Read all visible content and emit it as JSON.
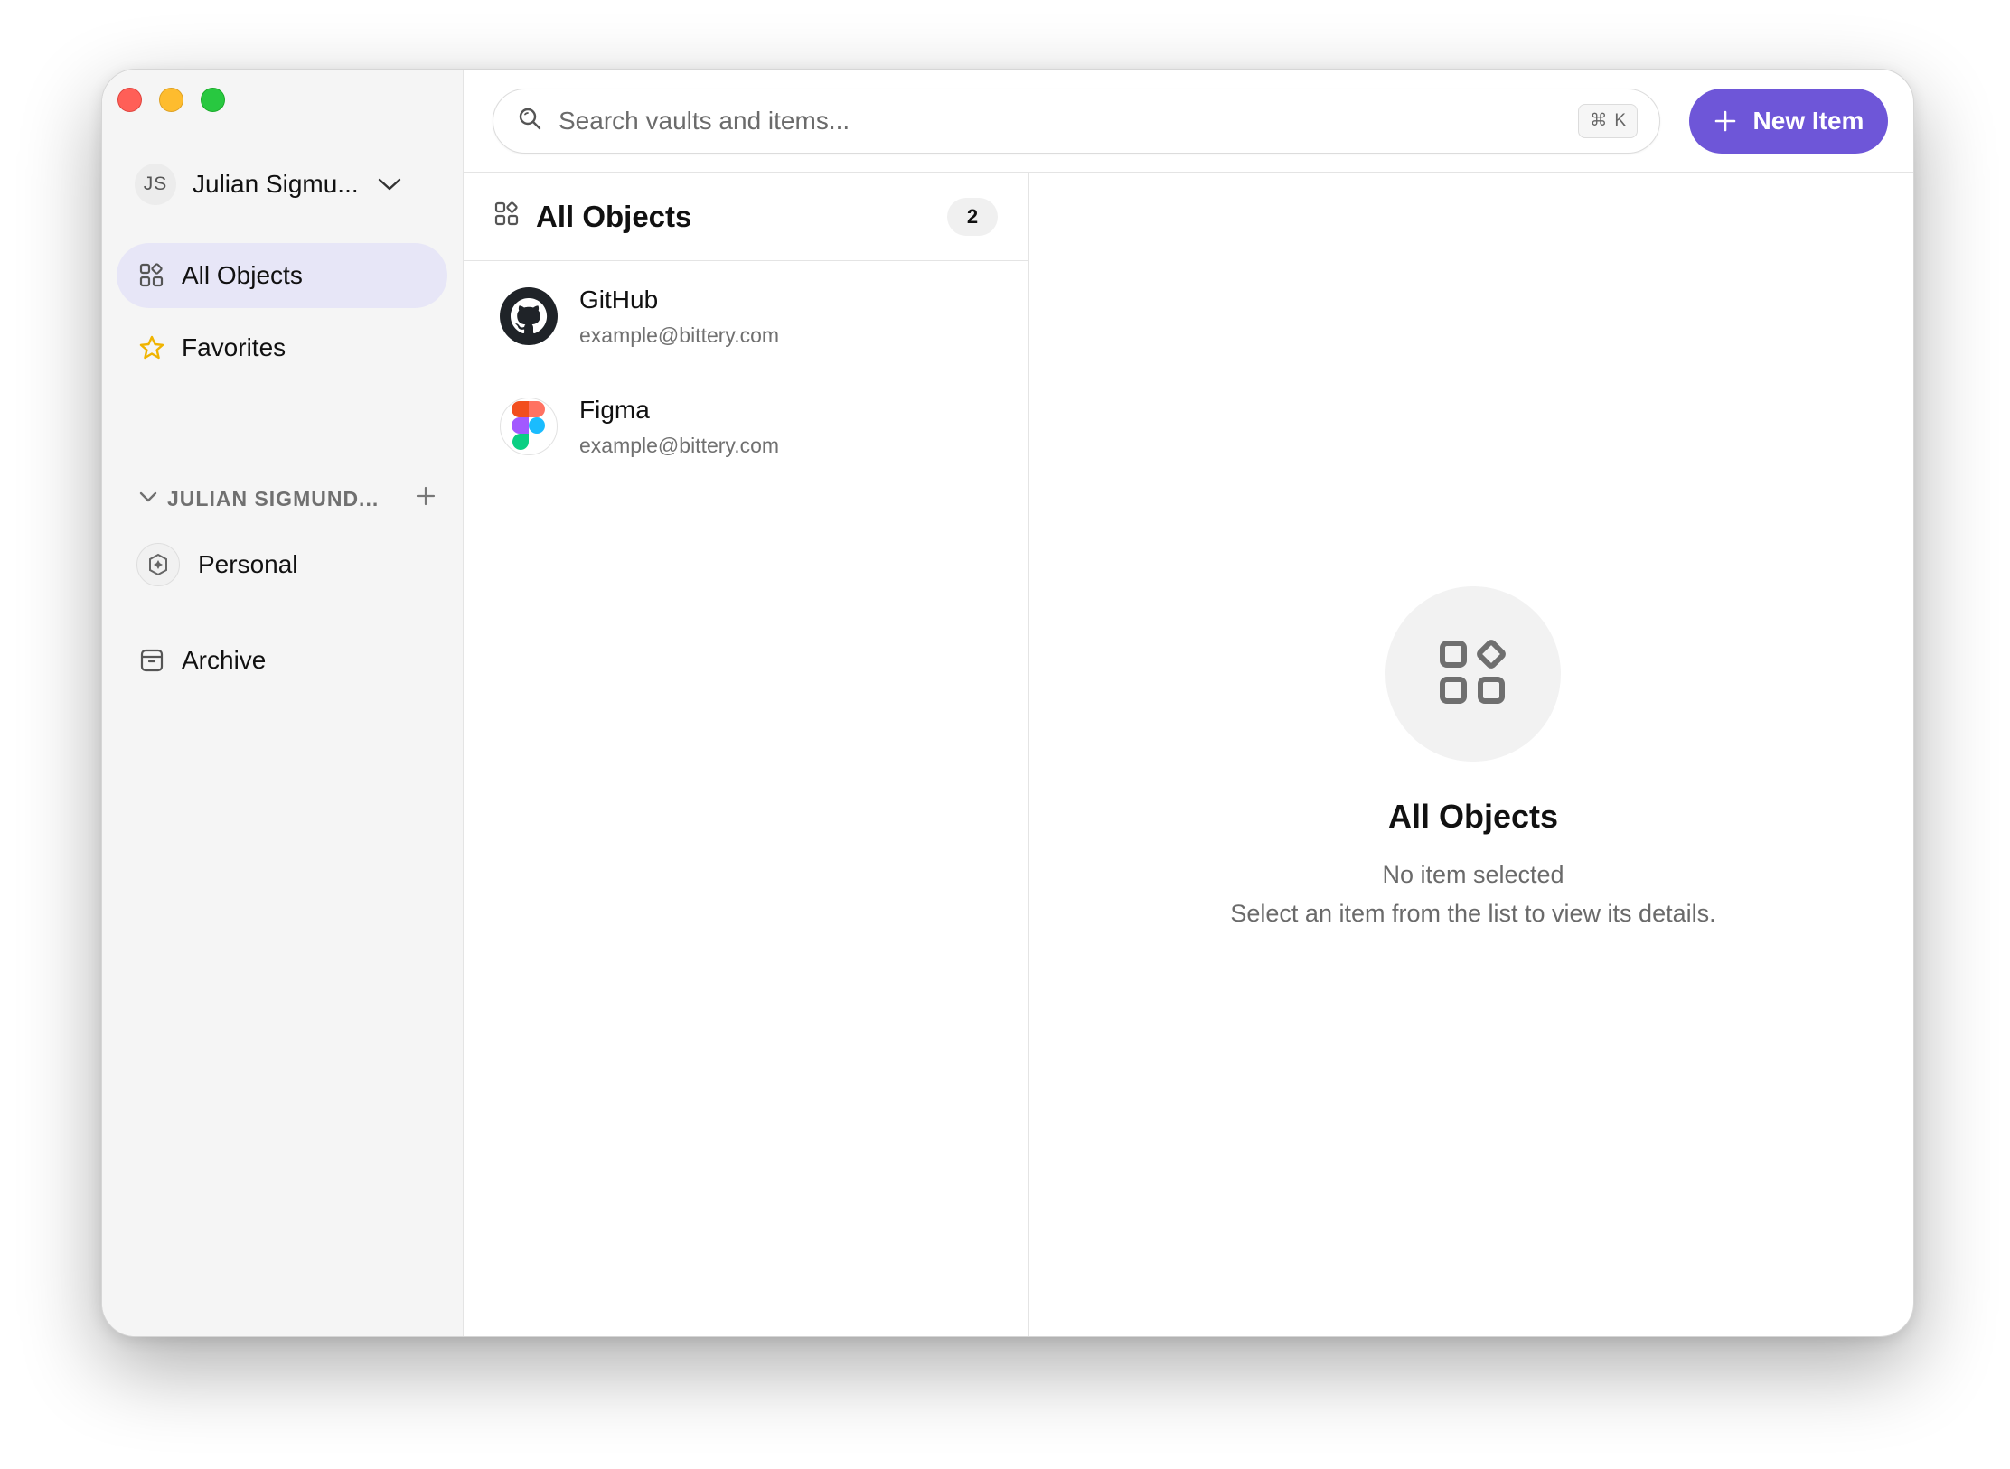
{
  "window": {
    "traffic_lights": [
      "close",
      "minimize",
      "zoom"
    ]
  },
  "account": {
    "initials": "JS",
    "name": "Julian Sigmu..."
  },
  "sidebar": {
    "items": [
      {
        "label": "All Objects",
        "icon": "grid-icon",
        "active": true
      },
      {
        "label": "Favorites",
        "icon": "star-icon",
        "active": false
      }
    ],
    "section": {
      "label": "JULIAN SIGMUND..."
    },
    "vaults": [
      {
        "label": "Personal",
        "icon": "vault-icon"
      }
    ],
    "archive": {
      "label": "Archive",
      "icon": "archive-icon"
    }
  },
  "search": {
    "placeholder": "Search vaults and items...",
    "shortcut_symbol": "⌘",
    "shortcut_key": "K"
  },
  "toolbar": {
    "new_label": "New Item"
  },
  "list": {
    "title": "All Objects",
    "count": "2",
    "items": [
      {
        "title": "GitHub",
        "subtitle": "example@bittery.com",
        "icon": "github-icon"
      },
      {
        "title": "Figma",
        "subtitle": "example@bittery.com",
        "icon": "figma-icon"
      }
    ]
  },
  "detail": {
    "title": "All Objects",
    "line1": "No item selected",
    "line2": "Select an item from the list to view its details."
  },
  "colors": {
    "accent": "#6e56d8",
    "active_bg": "#e7e6f7",
    "sidebar_bg": "#f5f5f5",
    "star": "#f0b400",
    "close": "#ff5f57",
    "minimize": "#febc2e",
    "zoom": "#28c840"
  }
}
